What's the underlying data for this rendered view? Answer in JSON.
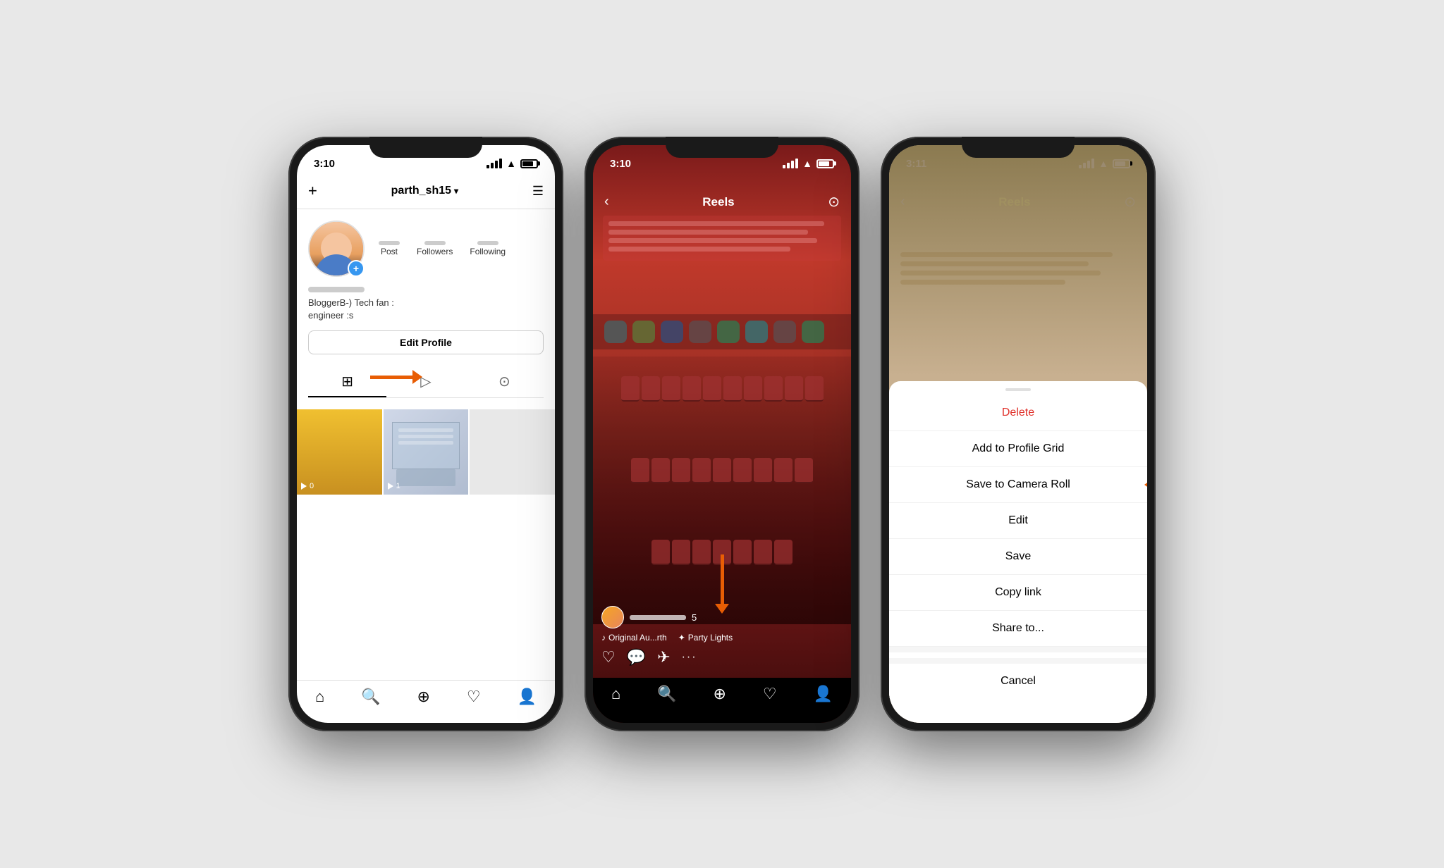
{
  "phone1": {
    "status_time": "3:10",
    "username": "parth_sh15",
    "stats": {
      "post_label": "Post",
      "followers_label": "Followers",
      "following_label": "Following"
    },
    "bio": {
      "line1": "BloggerB-) Tech fan :  ",
      "line2": "engineer :s"
    },
    "edit_profile": "Edit Profile",
    "tabs": [
      "grid",
      "reels",
      "tagged"
    ],
    "videos": [
      {
        "count": "0"
      },
      {
        "count": "1"
      }
    ]
  },
  "phone2": {
    "status_time": "3:10",
    "header": {
      "title": "Reels",
      "back_icon": "‹",
      "camera_icon": "⊙"
    },
    "reel_count": "5",
    "music1": "Original Au...rth",
    "music2": "Party Lights",
    "actions": [
      "♡",
      "💬",
      "✈",
      "···"
    ]
  },
  "phone3": {
    "status_time": "3:11",
    "header": {
      "title": "Reels",
      "back_icon": "‹",
      "camera_icon": "⊙"
    },
    "sheet_items": [
      {
        "label": "Delete",
        "style": "delete"
      },
      {
        "label": "Add to Profile Grid",
        "style": "normal"
      },
      {
        "label": "Save to Camera Roll",
        "style": "normal"
      },
      {
        "label": "Edit",
        "style": "normal"
      },
      {
        "label": "Save",
        "style": "normal"
      },
      {
        "label": "Copy link",
        "style": "normal"
      },
      {
        "label": "Share to...",
        "style": "normal"
      }
    ],
    "cancel_label": "Cancel"
  }
}
